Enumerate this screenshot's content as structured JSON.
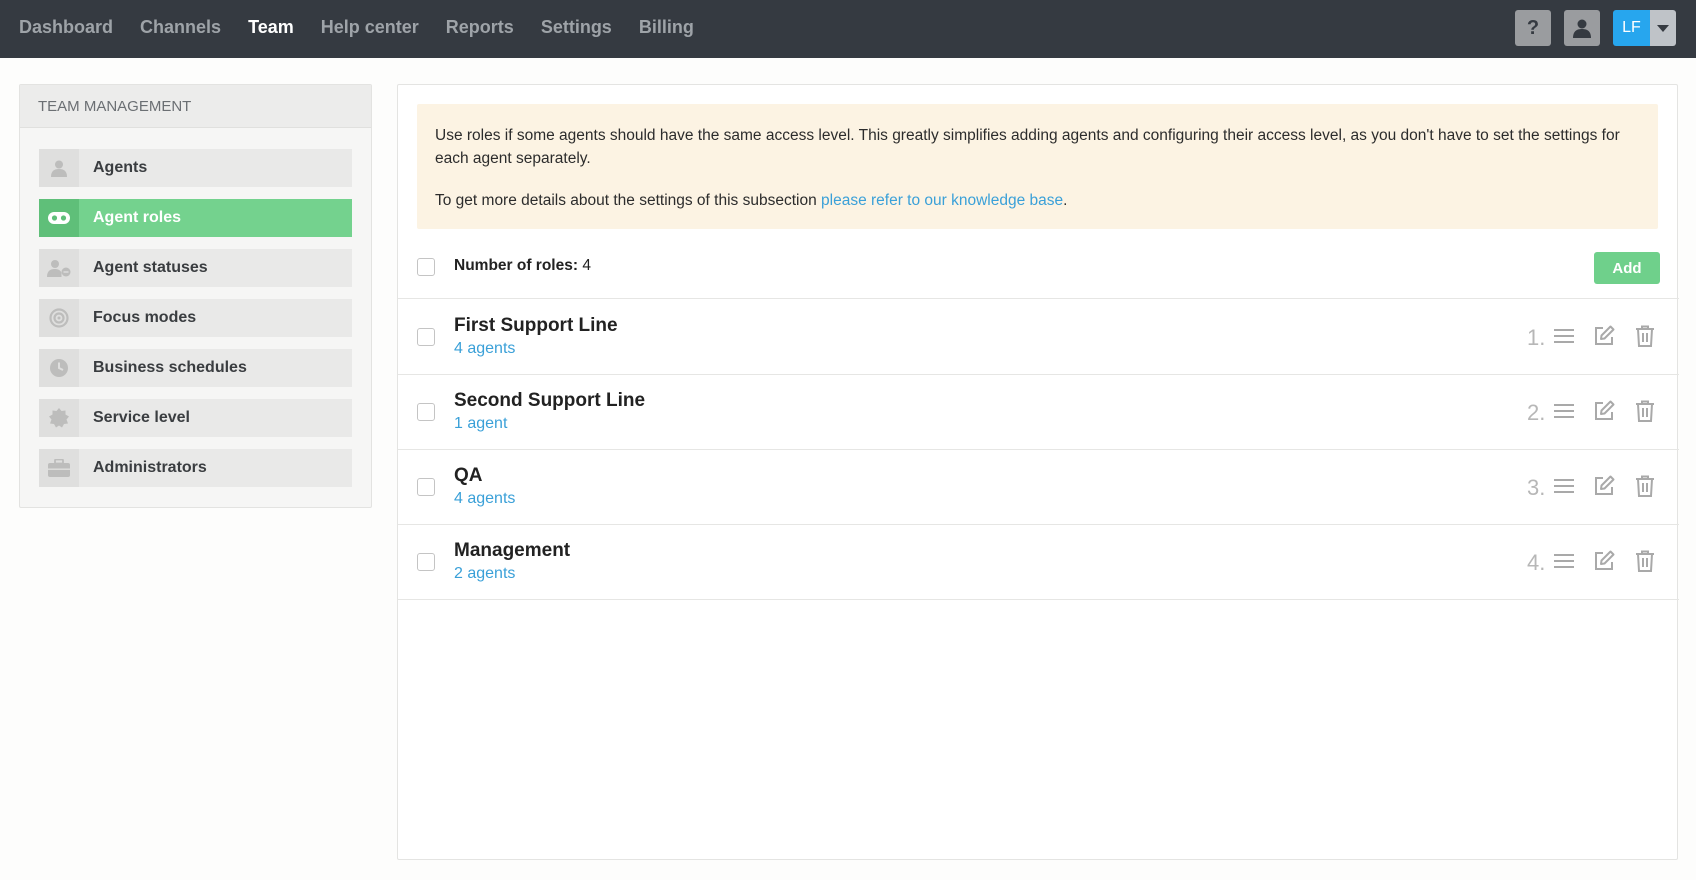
{
  "nav": {
    "items": [
      "Dashboard",
      "Channels",
      "Team",
      "Help center",
      "Reports",
      "Settings",
      "Billing"
    ],
    "active": "Team"
  },
  "top_actions": {
    "help_glyph": "?",
    "user_initials": "LF"
  },
  "sidebar": {
    "title": "TEAM MANAGEMENT",
    "items": [
      {
        "label": "Agents",
        "icon": "user-icon"
      },
      {
        "label": "Agent roles",
        "icon": "mask-icon",
        "active": true
      },
      {
        "label": "Agent statuses",
        "icon": "user-status-icon"
      },
      {
        "label": "Focus modes",
        "icon": "target-icon"
      },
      {
        "label": "Business schedules",
        "icon": "clock-icon"
      },
      {
        "label": "Service level",
        "icon": "gear-badge-icon"
      },
      {
        "label": "Administrators",
        "icon": "briefcase-icon"
      }
    ]
  },
  "notice": {
    "text1": "Use roles if some agents should have the same access level. This greatly simplifies adding agents and configuring their access level, as you don't have to set the settings for each agent separately.",
    "text2_prefix": "To get more details about the settings of this subsection ",
    "text2_link": "please refer to our knowledge base",
    "text2_suffix": "."
  },
  "roles": {
    "count_label": "Number of roles:",
    "count_value": "4",
    "add_label": "Add",
    "items": [
      {
        "name": "First Support Line",
        "agents": "4 agents",
        "order": "1."
      },
      {
        "name": "Second Support Line",
        "agents": "1 agent",
        "order": "2."
      },
      {
        "name": "QA",
        "agents": "4 agents",
        "order": "3."
      },
      {
        "name": "Management",
        "agents": "2 agents",
        "order": "4."
      }
    ]
  },
  "colors": {
    "topbar": "#353a41",
    "accent_green": "#74d28e",
    "link_blue": "#3aa0d8",
    "notice_bg": "#fcf3e3",
    "avatar_blue": "#27a6ee"
  }
}
